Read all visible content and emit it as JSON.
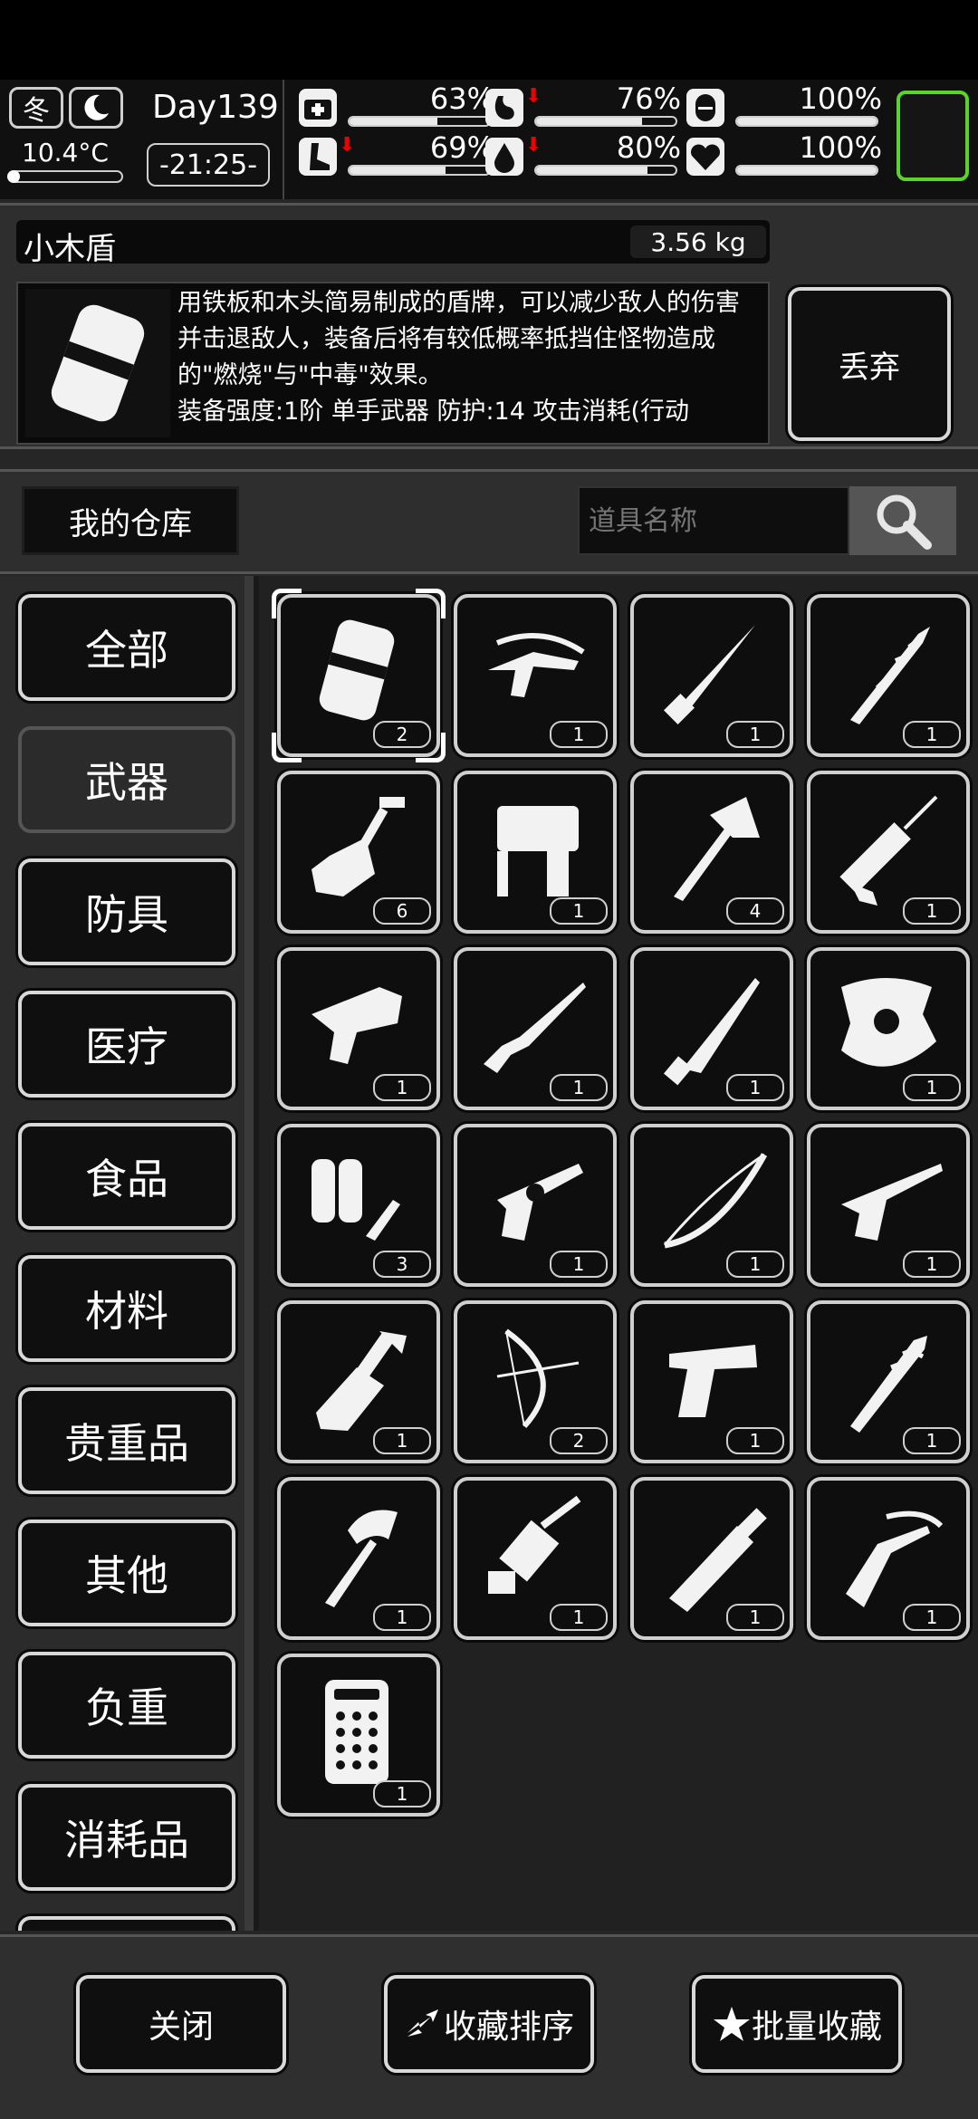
{
  "status": {
    "season": "冬",
    "temperature": "10.4°C",
    "day": "Day139",
    "time": "-21:25-",
    "stats": [
      {
        "name": "health",
        "icon": "medkit-icon",
        "value": 63,
        "label": "63%",
        "arrow": false
      },
      {
        "name": "hunger",
        "icon": "stomach-icon",
        "value": 76,
        "label": "76%",
        "arrow": true
      },
      {
        "name": "mood",
        "icon": "capsule-icon",
        "value": 100,
        "label": "100%",
        "arrow": false
      },
      {
        "name": "stamina",
        "icon": "leg-icon",
        "value": 69,
        "label": "69%",
        "arrow": true
      },
      {
        "name": "thirst",
        "icon": "water-drop-icon",
        "value": 80,
        "label": "80%",
        "arrow": true
      },
      {
        "name": "heart",
        "icon": "heart-icon",
        "value": 100,
        "label": "100%",
        "arrow": false
      }
    ]
  },
  "item": {
    "name": "小木盾",
    "weight": "3.56 kg",
    "description": "用铁板和木头简易制成的盾牌，可以减少敌人的伤害并击退敌人，装备后将有较低概率抵挡住怪物造成的\"燃烧\"与\"中毒\"效果。",
    "stats_line": "装备强度:1阶 单手武器 防护:14 攻击消耗(行动",
    "discard_label": "丢弃"
  },
  "storage": {
    "title": "我的仓库",
    "search_placeholder": "道具名称"
  },
  "categories": [
    "全部",
    "武器",
    "防具",
    "医疗",
    "食品",
    "材料",
    "贵重品",
    "其他",
    "负重",
    "消耗品"
  ],
  "active_category": "武器",
  "grid": [
    {
      "icon": "riot-shield-icon",
      "count": "2"
    },
    {
      "icon": "crossbow-pistol-icon",
      "count": "1"
    },
    {
      "icon": "knife-icon",
      "count": "1"
    },
    {
      "icon": "spiked-club-icon",
      "count": "1"
    },
    {
      "icon": "shovel-icon",
      "count": "6"
    },
    {
      "icon": "nail-gun-icon",
      "count": "1"
    },
    {
      "icon": "axe-icon",
      "count": "4"
    },
    {
      "icon": "caulk-gun-icon",
      "count": "1"
    },
    {
      "icon": "flare-gun-icon",
      "count": "1"
    },
    {
      "icon": "rifle-icon",
      "count": "1"
    },
    {
      "icon": "machete-icon",
      "count": "1"
    },
    {
      "icon": "round-shield-icon",
      "count": "1"
    },
    {
      "icon": "flamethrower-icon",
      "count": "3"
    },
    {
      "icon": "revolver-icon",
      "count": "1"
    },
    {
      "icon": "bow-icon",
      "count": "1"
    },
    {
      "icon": "long-revolver-icon",
      "count": "1"
    },
    {
      "icon": "cleaver-icon",
      "count": "1"
    },
    {
      "icon": "compound-bow-icon",
      "count": "2"
    },
    {
      "icon": "desert-eagle-icon",
      "count": "1"
    },
    {
      "icon": "nail-bat-icon",
      "count": "1"
    },
    {
      "icon": "hatchet-icon",
      "count": "1"
    },
    {
      "icon": "minigun-icon",
      "count": "1"
    },
    {
      "icon": "broadsword-icon",
      "count": "1"
    },
    {
      "icon": "crossbow-icon",
      "count": "1"
    },
    {
      "icon": "ballistic-shield-icon",
      "count": "1"
    }
  ],
  "footer": {
    "close_label": "关闭",
    "sort_label": "收藏排序",
    "batch_label": "批量收藏"
  }
}
